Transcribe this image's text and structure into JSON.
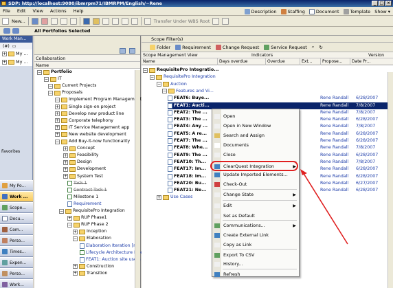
{
  "window": {
    "title": "SDP: http://localhost:9080/ibmrpm71/IBMRPM/English/~Rene"
  },
  "menu": {
    "items": [
      "File",
      "Edit",
      "View",
      "Actions",
      "Help"
    ]
  },
  "top_right": {
    "description": "Description",
    "staffing": "Staffing",
    "document": "Document",
    "template": "Template",
    "show": "Show"
  },
  "toolbar": {
    "new_label": "New...",
    "transfer_label": "Transfer Under WBS Root"
  },
  "breadcrumb": {
    "title": "All Portfolios Selected"
  },
  "left_nav": {
    "header": "Work Man...",
    "tools": "(#)",
    "items": [
      "My ...",
      "My ..."
    ],
    "favorites_label": "Favorites",
    "buttons": [
      "My Po...",
      "Work ...",
      "Scope...",
      "Docu...",
      "Com...",
      "Perso...",
      "Times...",
      "Expen...",
      "Perso...",
      "Work..."
    ]
  },
  "mid_pane": {
    "collab_label": "Collaboration",
    "name_header": "Name",
    "tree": [
      {
        "label": "Portfolio",
        "bold": true
      },
      {
        "label": "IT"
      },
      {
        "label": "Current Projects"
      },
      {
        "label": "Proposals"
      },
      {
        "label": "Implement Program Management Of"
      },
      {
        "label": "Single sign-on project"
      },
      {
        "label": "Develop new product line"
      },
      {
        "label": "Corporate telephony"
      },
      {
        "label": "IT Service Management app"
      },
      {
        "label": "New website development"
      },
      {
        "label": "Add Buy-it-now functionality"
      },
      {
        "label": "Concept"
      },
      {
        "label": "Feasibility"
      },
      {
        "label": "Design"
      },
      {
        "label": "Development"
      },
      {
        "label": "System Test"
      },
      {
        "label": "Task 1"
      },
      {
        "label": "Contract Task 1"
      },
      {
        "label": "Milestone 1"
      },
      {
        "label": "Requirement"
      },
      {
        "label": "RequisitePro Integration"
      },
      {
        "label": "RUP Phase1"
      },
      {
        "label": "RUP Phase 2"
      },
      {
        "label": "Inception"
      },
      {
        "label": "Elaboration"
      },
      {
        "label": "Elaboration Iteration [n]"
      },
      {
        "label": "Lifecycle Architecture Mile"
      },
      {
        "label": "FEAT1: Auction site users"
      },
      {
        "label": "Construction"
      },
      {
        "label": "Transition"
      }
    ]
  },
  "right_pane": {
    "scope_filter": "Scope Filter(s)",
    "tabs": [
      "Folder",
      "Requirement",
      "Change Request",
      "Service Request"
    ],
    "col_headers": {
      "scope_view": "Scope Management View",
      "indicators": "Indicators",
      "version": "Version"
    },
    "sub_headers": {
      "name": "Name",
      "days_overdue": "Days overdue",
      "overdue": "Overdue",
      "ext": "Ext...",
      "propose": "Propose...",
      "date_pr": "Date Pr..."
    },
    "rows": [
      {
        "label": "RequisitePro Integratio...",
        "bold": true,
        "owner": "",
        "date": ""
      },
      {
        "label": "RequisitePro Integration",
        "owner": "",
        "date": ""
      },
      {
        "label": "Auction",
        "owner": "",
        "date": ""
      },
      {
        "label": "Features and Vi...",
        "owner": "",
        "date": ""
      },
      {
        "label": "FEAT6: Buye...",
        "owner": "Rene Randall",
        "date": "6/28/2007"
      },
      {
        "label": "FEAT1: Aucti...",
        "owner": "Rene Randall",
        "date": "7/8/2007",
        "selected": true
      },
      {
        "label": "FEAT2: The ...",
        "owner": "Rene Randall",
        "date": "7/8/2007"
      },
      {
        "label": "FEAT3: The ...",
        "owner": "Rene Randall",
        "date": "6/28/2007"
      },
      {
        "label": "FEAT4: Any ...",
        "owner": "Rene Randall",
        "date": "7/8/2007"
      },
      {
        "label": "FEAT5: A re...",
        "owner": "Rene Randall",
        "date": "6/28/2007"
      },
      {
        "label": "FEAT7: The ...",
        "owner": "Rene Randall",
        "date": "6/28/2007"
      },
      {
        "label": "FEAT8: Whe...",
        "owner": "Rene Randall",
        "date": "7/8/2007"
      },
      {
        "label": "FEAT9: The ...",
        "owner": "Rene Randall",
        "date": "6/28/2007"
      },
      {
        "label": "FEAT10: Th...",
        "owner": "Rene Randall",
        "date": "7/8/2007"
      },
      {
        "label": "FEAT17: Im...",
        "owner": "Rene Randall",
        "date": "6/28/2007"
      },
      {
        "label": "FEAT18: Im...",
        "owner": "Rene Randall",
        "date": "6/28/2007"
      },
      {
        "label": "FEAT20: Bu...",
        "owner": "Rene Randall",
        "date": "6/27/2007"
      },
      {
        "label": "FEAT21: Ne...",
        "owner": "Rene Randall",
        "date": "6/28/2007"
      },
      {
        "label": "Use Cases",
        "owner": "",
        "date": ""
      }
    ]
  },
  "context_menu": {
    "items": [
      {
        "label": "Open"
      },
      {
        "label": "Open in New Window"
      },
      {
        "label": "Search and Assign"
      },
      {
        "label": "Documents"
      },
      {
        "label": "Close"
      },
      {
        "label": "ClearQuest Integration",
        "submenu": true
      },
      {
        "label": "Update Imported Elements...",
        "highlighted": true
      },
      {
        "label": "Check-Out"
      },
      {
        "label": "Change State",
        "submenu": true
      },
      {
        "label": "Edit",
        "submenu": true
      },
      {
        "label": "Set as Default"
      },
      {
        "label": "Communications...",
        "submenu": true
      },
      {
        "label": "Create External Link"
      },
      {
        "label": "Copy as Link"
      },
      {
        "label": "Export To CSV"
      },
      {
        "label": "History..."
      },
      {
        "label": "Refresh"
      }
    ]
  },
  "colors": {
    "selection": "#0a246a",
    "highlight_annotation": "#e02020",
    "link": "#1a3aa8"
  }
}
